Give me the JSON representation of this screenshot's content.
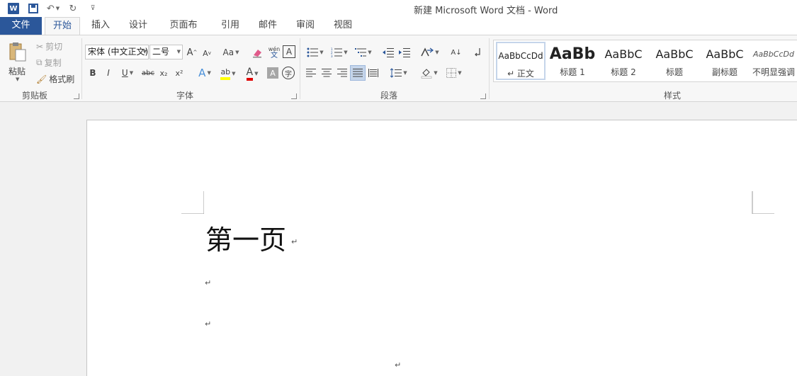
{
  "titlebar": {
    "logo_letter": "W",
    "undo_glyph": "↶",
    "redo_glyph": "↻",
    "customize_glyph": "⊽",
    "window_title": "新建 Microsoft Word 文档 - Word"
  },
  "tabs": [
    {
      "label": "文件"
    },
    {
      "label": "开始"
    },
    {
      "label": "插入"
    },
    {
      "label": "设计"
    },
    {
      "label": "页面布局"
    },
    {
      "label": "引用"
    },
    {
      "label": "邮件"
    },
    {
      "label": "审阅"
    },
    {
      "label": "视图"
    }
  ],
  "clipboard": {
    "paste_label": "粘贴",
    "cut_label": "剪切",
    "copy_label": "复制",
    "format_painter_label": "格式刷",
    "group_label": "剪贴板"
  },
  "font": {
    "font_name": "宋体 (中文正文)",
    "font_size": "二号",
    "grow_glyph": "A",
    "shrink_glyph": "A",
    "case_glyph": "Aa",
    "phonetic_glyph": "wén",
    "border_glyph": "A",
    "bold": "B",
    "italic": "I",
    "underline": "U",
    "strike": "abc",
    "subscript": "x₂",
    "superscript": "x²",
    "effects_glyph": "A",
    "highlight_glyph": "ab",
    "color_glyph": "A",
    "shading_glyph": "A",
    "enclose_glyph": "字",
    "group_label": "字体"
  },
  "paragraph": {
    "sort_glyph": "A↓",
    "group_label": "段落"
  },
  "styles": {
    "items": [
      {
        "sample": "AaBbCcDd",
        "name": "↵ 正文"
      },
      {
        "sample": "AaBb",
        "name": "标题 1"
      },
      {
        "sample": "AaBbC",
        "name": "标题 2"
      },
      {
        "sample": "AaBbC",
        "name": "标题"
      },
      {
        "sample": "AaBbC",
        "name": "副标题"
      },
      {
        "sample": "AaBbCcDd",
        "name": "不明显强调"
      }
    ],
    "group_label": "样式"
  },
  "document": {
    "heading": "第一页",
    "para_mark": "↵"
  },
  "colors": {
    "brand": "#2b579a",
    "highlight": "#ffff00",
    "font_color": "#e00000"
  }
}
